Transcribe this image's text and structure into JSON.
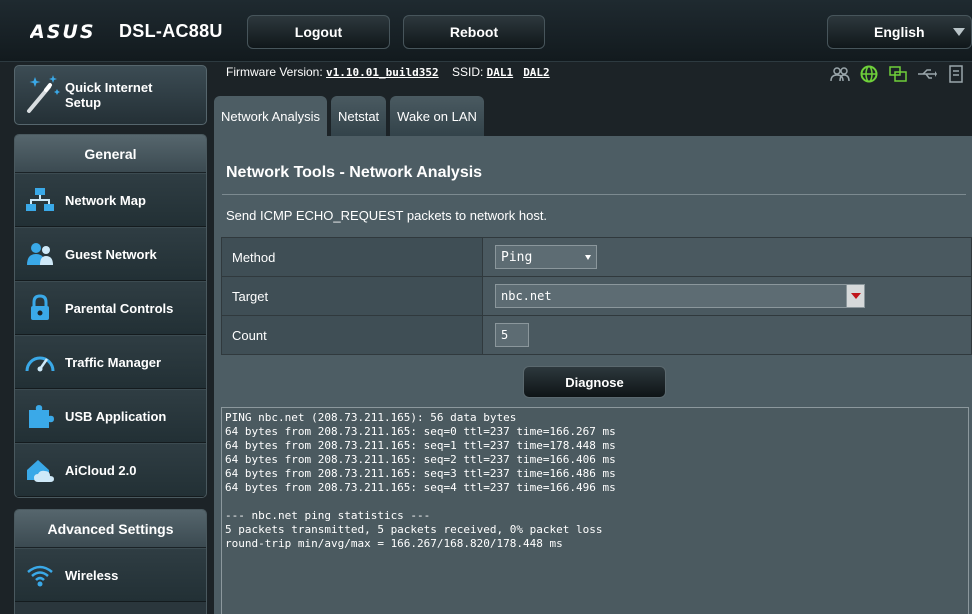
{
  "header": {
    "brand": "/ISUS",
    "model": "DSL-AC88U",
    "logout_label": "Logout",
    "reboot_label": "Reboot",
    "language": "English"
  },
  "firmware": {
    "label": "Firmware Version:",
    "version": "v1.10.01_build352",
    "ssid_label": "SSID:",
    "ssid_1": "DAL1",
    "ssid_2": "DAL2"
  },
  "status_icons": [
    "clients-icon",
    "internet-globe-icon",
    "network-devices-icon",
    "usb-icon",
    "printer-icon"
  ],
  "sidebar": {
    "quick_setup": "Quick Internet Setup",
    "general_title": "General",
    "general_items": [
      {
        "label": "Network Map",
        "icon": "network-map-icon"
      },
      {
        "label": "Guest Network",
        "icon": "guest-network-icon"
      },
      {
        "label": "Parental Controls",
        "icon": "parental-lock-icon"
      },
      {
        "label": "Traffic Manager",
        "icon": "speedometer-icon"
      },
      {
        "label": "USB Application",
        "icon": "puzzle-icon"
      },
      {
        "label": "AiCloud 2.0",
        "icon": "cloud-home-icon"
      }
    ],
    "advanced_title": "Advanced Settings",
    "advanced_items": [
      {
        "label": "Wireless",
        "icon": "wifi-icon"
      }
    ]
  },
  "tabs": [
    {
      "label": "Network Analysis",
      "active": true
    },
    {
      "label": "Netstat",
      "active": false
    },
    {
      "label": "Wake on LAN",
      "active": false
    }
  ],
  "panel": {
    "title": "Network Tools - Network Analysis",
    "description": "Send ICMP ECHO_REQUEST packets to network host.",
    "method_label": "Method",
    "method_value": "Ping",
    "target_label": "Target",
    "target_value": "nbc.net",
    "count_label": "Count",
    "count_value": "5",
    "diagnose_label": "Diagnose",
    "output": "PING nbc.net (208.73.211.165): 56 data bytes\n64 bytes from 208.73.211.165: seq=0 ttl=237 time=166.267 ms\n64 bytes from 208.73.211.165: seq=1 ttl=237 time=178.448 ms\n64 bytes from 208.73.211.165: seq=2 ttl=237 time=166.406 ms\n64 bytes from 208.73.211.165: seq=3 ttl=237 time=166.486 ms\n64 bytes from 208.73.211.165: seq=4 ttl=237 time=166.496 ms\n\n--- nbc.net ping statistics ---\n5 packets transmitted, 5 packets received, 0% packet loss\nround-trip min/avg/max = 166.267/168.820/178.448 ms"
  },
  "colors": {
    "accent_green": "#6fd03a",
    "icon_blue": "#3aa9e8",
    "panel_bg": "#4d5d64"
  }
}
